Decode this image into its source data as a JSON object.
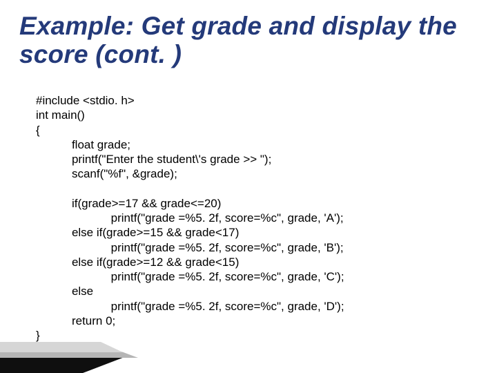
{
  "title": "Example: Get grade and display the score (cont. )",
  "code": "#include <stdio. h>\nint main()\n{\n           float grade;\n           printf(\"Enter the student\\'s grade >> \");\n           scanf(\"%f\", &grade);\n\n           if(grade>=17 && grade<=20)\n                       printf(\"grade =%5. 2f, score=%c\", grade, 'A');\n           else if(grade>=15 && grade<17)\n                       printf(\"grade =%5. 2f, score=%c\", grade, 'B');\n           else if(grade>=12 && grade<15)\n                       printf(\"grade =%5. 2f, score=%c\", grade, 'C');\n           else\n                       printf(\"grade =%5. 2f, score=%c\", grade, 'D');\n           return 0;\n}"
}
